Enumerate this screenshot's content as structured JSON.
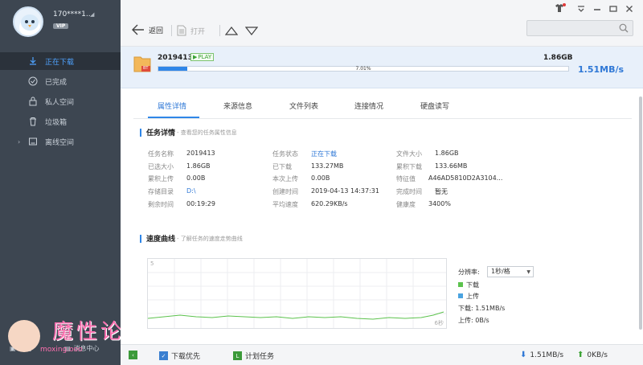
{
  "sidebar": {
    "username": "170****1...",
    "vip": "VIP",
    "items": [
      {
        "label": "正在下载",
        "icon": "download-icon",
        "active": true
      },
      {
        "label": "已完成",
        "icon": "check-circle-icon"
      },
      {
        "label": "私人空间",
        "icon": "lock-icon"
      },
      {
        "label": "垃圾箱",
        "icon": "trash-icon"
      },
      {
        "label": "离线空间",
        "icon": "cloud-drive-icon"
      }
    ],
    "bottom": {
      "apps": "应用",
      "messages": "消息中心"
    }
  },
  "watermark": {
    "text": "魔性论坛",
    "url": "moxing.ooo"
  },
  "toolbar": {
    "back": "返回",
    "open": "打开"
  },
  "task": {
    "name": "2019413",
    "play_tag": "PLAY",
    "type_badge": "BT",
    "size": "1.86GB",
    "progress_label": "7.01%",
    "progress": 0.0701,
    "speed": "1.51MB/s"
  },
  "tabs": [
    "属性详情",
    "来源信息",
    "文件列表",
    "连接情况",
    "硬盘读写"
  ],
  "details": {
    "title": "任务详情",
    "subtitle": "- 查看您的任务属性信息",
    "col1": [
      {
        "label": "任务名称",
        "value": "2019413"
      },
      {
        "label": "已选大小",
        "value": "1.86GB"
      },
      {
        "label": "累积上传",
        "value": "0.00B"
      },
      {
        "label": "存储目录",
        "value": "D:\\",
        "link": true
      },
      {
        "label": "剩余时间",
        "value": "00:19:29"
      }
    ],
    "col2": [
      {
        "label": "任务状态",
        "value": "正在下载",
        "link": true
      },
      {
        "label": "已下载",
        "value": "133.27MB"
      },
      {
        "label": "本次上传",
        "value": "0.00B"
      },
      {
        "label": "创建时间",
        "value": "2019-04-13 14:37:31"
      },
      {
        "label": "平均速度",
        "value": "620.29KB/s"
      }
    ],
    "col3": [
      {
        "label": "文件大小",
        "value": "1.86GB"
      },
      {
        "label": "累积下载",
        "value": "133.66MB"
      },
      {
        "label": "特征值",
        "value": "A46AD5810D2A3104..."
      },
      {
        "label": "完成时间",
        "value": "暂无"
      },
      {
        "label": "健康度",
        "value": "3400%"
      }
    ]
  },
  "speed_section": {
    "title": "速度曲线",
    "subtitle": "- 了解任务的速度走势曲线",
    "chart_top_label": "5",
    "chart_right_label": "6秒",
    "resolution_label": "分辨率:",
    "resolution_value": "1秒/格",
    "legend_download": "下载",
    "legend_upload": "上传",
    "download_speed": "下载:  1.51MB/s",
    "upload_speed": "上传:  0B/s",
    "download_color": "#5cc24d",
    "upload_color": "#4aa3e0"
  },
  "statusbar": {
    "download_first": "下载优先",
    "scheduled": "计划任务",
    "down_speed": "1.51MB/s",
    "up_speed": "0KB/s"
  }
}
